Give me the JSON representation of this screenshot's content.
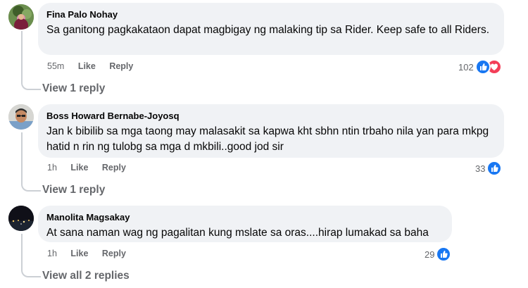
{
  "comments": [
    {
      "author": "Fina Palo Nohay",
      "text": "Sa ganitong pagkakataon dapat magbigay ng malaking tip sa Rider. Keep safe to all Riders.",
      "time": "55m",
      "like_label": "Like",
      "reply_label": "Reply",
      "reaction_count": "102",
      "reactions": [
        "like-icon",
        "love-icon"
      ],
      "view_replies": "View 1 reply"
    },
    {
      "author": "Boss Howard Bernabe-Joyosq",
      "text": "Jan k bibilib sa mga taong may malasakit sa kapwa kht sbhn ntin trbaho nila yan para mkpg hatid n rin ng tulobg sa mga d mkbili..good jod sir",
      "time": "1h",
      "like_label": "Like",
      "reply_label": "Reply",
      "reaction_count": "33",
      "reactions": [
        "like-icon"
      ],
      "view_replies": "View 1 reply"
    },
    {
      "author": "Manolita Magsakay",
      "text": "At sana naman wag ng pagalitan kung mslate sa oras....hirap lumakad sa baha",
      "time": "1h",
      "like_label": "Like",
      "reply_label": "Reply",
      "reaction_count": "29",
      "reactions": [
        "like-icon"
      ],
      "view_replies": "View all 2 replies"
    }
  ],
  "colors": {
    "like": "#1877f2",
    "love": "#f33e58",
    "bubble": "#f0f2f5",
    "secondary_text": "#65676b"
  }
}
